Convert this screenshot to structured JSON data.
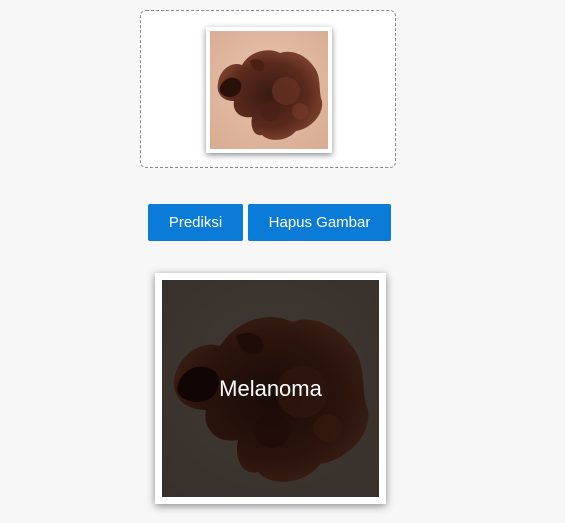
{
  "upload": {
    "preview_image": "skin-lesion-photo"
  },
  "actions": {
    "predict_label": "Prediksi",
    "clear_label": "Hapus Gambar"
  },
  "result": {
    "prediction": "Melanoma",
    "image": "skin-lesion-photo-darkened"
  },
  "colors": {
    "button_bg": "#0a7bd6",
    "page_bg": "#f7f7f7"
  }
}
